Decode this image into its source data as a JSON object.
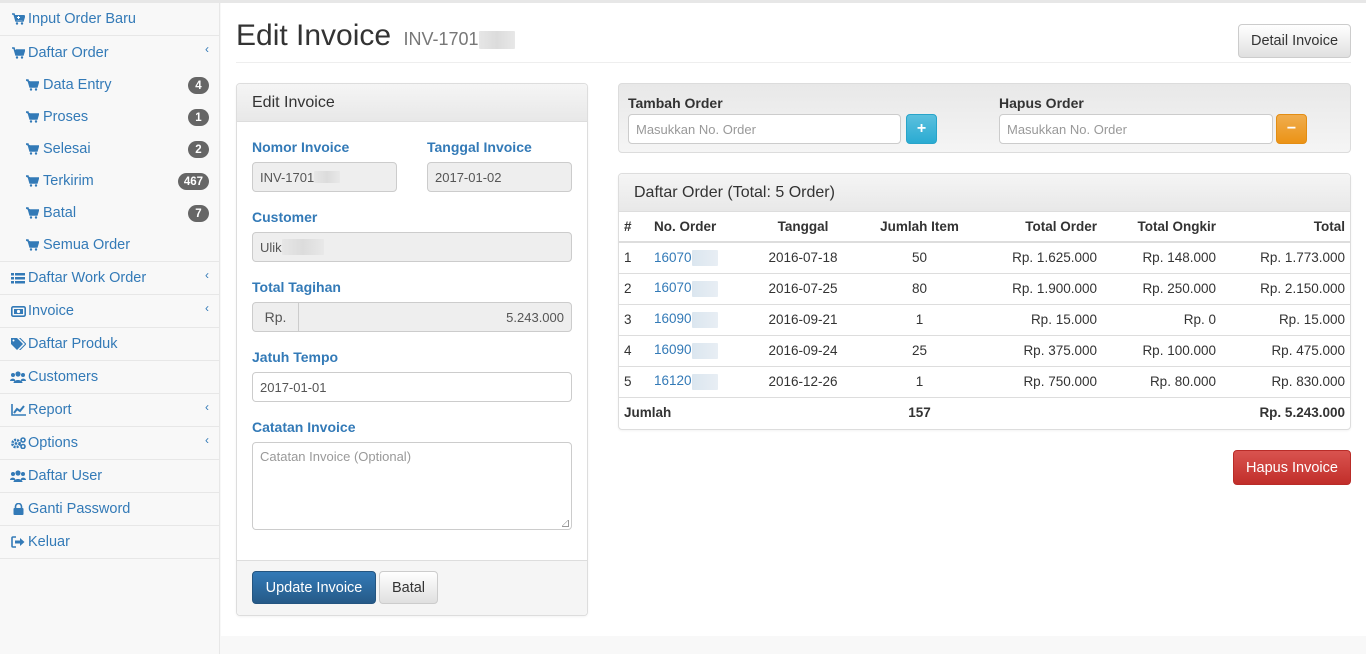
{
  "sidebar": {
    "input_order_baru": "Input Order Baru",
    "daftar_order": {
      "label": "Daftar Order",
      "items": [
        {
          "label": "Data Entry",
          "badge": "4"
        },
        {
          "label": "Proses",
          "badge": "1"
        },
        {
          "label": "Selesai",
          "badge": "2"
        },
        {
          "label": "Terkirim",
          "badge": "467"
        },
        {
          "label": "Batal",
          "badge": "7"
        },
        {
          "label": "Semua Order",
          "badge": null
        }
      ]
    },
    "items": [
      {
        "label": "Daftar Work Order",
        "icon": "list-icon",
        "chevron": true
      },
      {
        "label": "Invoice",
        "icon": "money-icon",
        "chevron": true
      },
      {
        "label": "Daftar Produk",
        "icon": "tags-icon",
        "chevron": false
      },
      {
        "label": "Customers",
        "icon": "users-icon",
        "chevron": false
      },
      {
        "label": "Report",
        "icon": "line-chart-icon",
        "chevron": true
      },
      {
        "label": "Options",
        "icon": "cogs-icon",
        "chevron": true
      },
      {
        "label": "Daftar User",
        "icon": "users-icon",
        "chevron": false
      },
      {
        "label": "Ganti Password",
        "icon": "lock-icon",
        "chevron": false
      },
      {
        "label": "Keluar",
        "icon": "sign-out-icon",
        "chevron": false
      }
    ]
  },
  "header": {
    "title": "Edit Invoice",
    "subtitle": "INV-1701",
    "detail_button": "Detail Invoice"
  },
  "edit_panel": {
    "heading": "Edit Invoice",
    "nomor_invoice_label": "Nomor Invoice",
    "nomor_invoice_value": "INV-1701",
    "tanggal_invoice_label": "Tanggal Invoice",
    "tanggal_invoice_value": "2017-01-02",
    "customer_label": "Customer",
    "customer_value": "Ulik",
    "total_tagihan_label": "Total Tagihan",
    "total_tagihan_prefix": "Rp.",
    "total_tagihan_value": "5.243.000",
    "jatuh_tempo_label": "Jatuh Tempo",
    "jatuh_tempo_value": "2017-01-01",
    "catatan_label": "Catatan Invoice",
    "catatan_placeholder": "Catatan Invoice (Optional)",
    "update_button": "Update Invoice",
    "batal_button": "Batal"
  },
  "order_actions": {
    "tambah_label": "Tambah Order",
    "tambah_placeholder": "Masukkan No. Order",
    "hapus_label": "Hapus Order",
    "hapus_placeholder": "Masukkan No. Order",
    "plus": "+",
    "minus": "−"
  },
  "order_table": {
    "heading": "Daftar Order (Total: 5 Order)",
    "columns": [
      "#",
      "No. Order",
      "Tanggal",
      "Jumlah Item",
      "Total Order",
      "Total Ongkir",
      "Total"
    ],
    "rows": [
      {
        "no": "1",
        "order": "16070",
        "tanggal": "2016-07-18",
        "jumlah": "50",
        "total_order": "Rp. 1.625.000",
        "ongkir": "Rp. 148.000",
        "total": "Rp. 1.773.000"
      },
      {
        "no": "2",
        "order": "16070",
        "tanggal": "2016-07-25",
        "jumlah": "80",
        "total_order": "Rp. 1.900.000",
        "ongkir": "Rp. 250.000",
        "total": "Rp. 2.150.000"
      },
      {
        "no": "3",
        "order": "16090",
        "tanggal": "2016-09-21",
        "jumlah": "1",
        "total_order": "Rp. 15.000",
        "ongkir": "Rp. 0",
        "total": "Rp. 15.000"
      },
      {
        "no": "4",
        "order": "16090",
        "tanggal": "2016-09-24",
        "jumlah": "25",
        "total_order": "Rp. 375.000",
        "ongkir": "Rp. 100.000",
        "total": "Rp. 475.000"
      },
      {
        "no": "5",
        "order": "16120",
        "tanggal": "2016-12-26",
        "jumlah": "1",
        "total_order": "Rp. 750.000",
        "ongkir": "Rp. 80.000",
        "total": "Rp. 830.000"
      }
    ],
    "footer": {
      "label": "Jumlah",
      "jumlah": "157",
      "total": "Rp. 5.243.000"
    }
  },
  "hapus_invoice_button": "Hapus Invoice"
}
